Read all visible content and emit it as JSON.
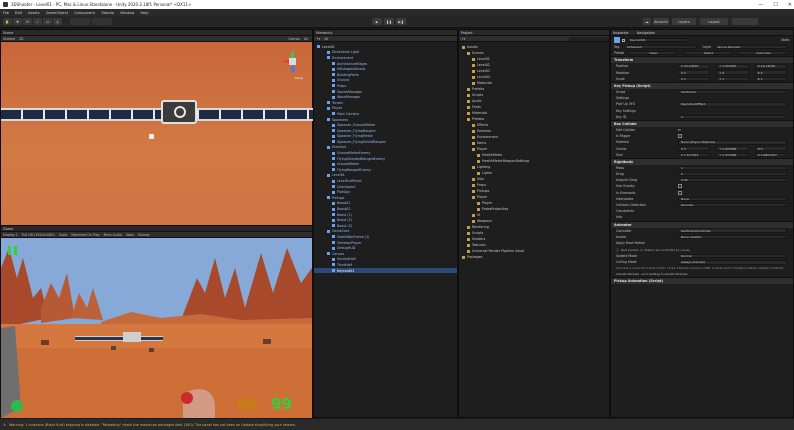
{
  "window": {
    "title": "3DShooter - Level01 - PC, Mac & Linux Standalone - Unity 2020.3.18f1 Personal* <DX11>",
    "min": "—",
    "max": "☐",
    "close": "✕"
  },
  "menu": [
    "File",
    "Edit",
    "Assets",
    "GameObject",
    "Component",
    "Tutorial",
    "Window",
    "Help"
  ],
  "toolbar": {
    "layers": "Layers",
    "layout": "Layout",
    "account": "Account"
  },
  "scene": {
    "tab": "Scene",
    "shading": "Shaded",
    "mode": "2D",
    "gizmos": "Gizmos",
    "search": "All",
    "persp": "Persp"
  },
  "game": {
    "tab": "Game",
    "display": "Display 1",
    "resolution": "Full HD (1920x1080)",
    "scale": "Scale",
    "maximize": "Maximize On Play",
    "mute": "Mute Audio",
    "stats": "Stats",
    "gizmos": "Gizmos",
    "ammo": "99",
    "pause_icon": "pause-icon"
  },
  "hierarchy": {
    "tab": "Hierarchy",
    "search": "All",
    "rows": [
      {
        "t": "Level01",
        "d": 0,
        "c": "dim"
      },
      {
        "t": "Directional Light",
        "d": 2
      },
      {
        "t": "Environment",
        "d": 2
      },
      {
        "t": "ArchitectureEdges",
        "d": 3
      },
      {
        "t": "HillshapesDetails",
        "d": 3
      },
      {
        "t": "BuildingParts",
        "d": 3
      },
      {
        "t": "Ground",
        "d": 3
      },
      {
        "t": "Props",
        "d": 3
      },
      {
        "t": "SpawnManager",
        "d": 3
      },
      {
        "t": "WaveManager",
        "d": 3
      },
      {
        "t": "Terrain",
        "d": 2
      },
      {
        "t": "Player",
        "d": 2
      },
      {
        "t": "Main Camera",
        "d": 3
      },
      {
        "t": "Spawners",
        "d": 2
      },
      {
        "t": "Spawner_GroundMelee",
        "d": 3
      },
      {
        "t": "Spawner_FlyingRanged",
        "d": 3
      },
      {
        "t": "Spawner_FlyingMelee",
        "d": 3
      },
      {
        "t": "Spawner_FlyingShieldRanged",
        "d": 3
      },
      {
        "t": "Enemies",
        "d": 2
      },
      {
        "t": "GroundMeleeEnemy",
        "d": 3
      },
      {
        "t": "FlyingShieldedRangedEnemy",
        "d": 3
      },
      {
        "t": "GroundMelee",
        "d": 3
      },
      {
        "t": "FlyingRangedEnemy",
        "d": 3
      },
      {
        "t": "Level01",
        "d": 2
      },
      {
        "t": "LevelEndPortal",
        "d": 3
      },
      {
        "t": "Checkpoint",
        "d": 3
      },
      {
        "t": "PlotSign",
        "d": 3
      },
      {
        "t": "Pickups",
        "d": 2
      },
      {
        "t": "Boost01",
        "d": 3
      },
      {
        "t": "Boost02",
        "d": 3
      },
      {
        "t": "Boost (1)",
        "d": 3
      },
      {
        "t": "Boost (2)",
        "d": 3
      },
      {
        "t": "Boost (3)",
        "d": 3
      },
      {
        "t": "GameCore",
        "d": 2
      },
      {
        "t": "HealthBarFrame (1)",
        "d": 3
      },
      {
        "t": "SkeletonPlayer",
        "d": 3
      },
      {
        "t": "DebugHUD",
        "d": 3
      },
      {
        "t": "Canvas",
        "d": 2
      },
      {
        "t": "SecondHalf",
        "d": 3
      },
      {
        "t": "ThirdHalf",
        "d": 3
      },
      {
        "t": "Keycard01",
        "d": 3,
        "c": "sel"
      }
    ]
  },
  "project": {
    "tab": "Project",
    "rows": [
      {
        "t": "Assets",
        "d": 0
      },
      {
        "t": "Scenes",
        "d": 1
      },
      {
        "t": "Level01",
        "d": 2
      },
      {
        "t": "Level02",
        "d": 2
      },
      {
        "t": "Level03",
        "d": 2
      },
      {
        "t": "Level04",
        "d": 2
      },
      {
        "t": "Materials",
        "d": 2
      },
      {
        "t": "Prefabs",
        "d": 1
      },
      {
        "t": "Scripts",
        "d": 1
      },
      {
        "t": "Audio",
        "d": 1
      },
      {
        "t": "Fonts",
        "d": 1
      },
      {
        "t": "Materials",
        "d": 1
      },
      {
        "t": "Prefabs",
        "d": 1
      },
      {
        "t": "Effects",
        "d": 2
      },
      {
        "t": "Enemies",
        "d": 2
      },
      {
        "t": "Environment",
        "d": 2
      },
      {
        "t": "Items",
        "d": 2
      },
      {
        "t": "Player",
        "d": 2
      },
      {
        "t": "HealthMeter",
        "d": 3
      },
      {
        "t": "HealthMeterWeaponSettings",
        "d": 3
      },
      {
        "t": "Lighting",
        "d": 2
      },
      {
        "t": "Lights",
        "d": 3
      },
      {
        "t": "Misc",
        "d": 2
      },
      {
        "t": "Props",
        "d": 2
      },
      {
        "t": "Pickups",
        "d": 2
      },
      {
        "t": "Player",
        "d": 2
      },
      {
        "t": "Player",
        "d": 3
      },
      {
        "t": "ProbeProjectiles",
        "d": 3
      },
      {
        "t": "UI",
        "d": 2
      },
      {
        "t": "Weapons",
        "d": 2
      },
      {
        "t": "Rendering",
        "d": 1
      },
      {
        "t": "Scripts",
        "d": 1
      },
      {
        "t": "Shaders",
        "d": 1
      },
      {
        "t": "Textures",
        "d": 1
      },
      {
        "t": "Universal Render Pipeline Asset",
        "d": 1
      },
      {
        "t": "Packages",
        "d": 0
      }
    ]
  },
  "inspector": {
    "tab": "Inspector",
    "tab2": "Navigation",
    "name": "Keycard01",
    "static": "Static",
    "tag_label": "Tag",
    "tag": "Untagged",
    "layer_label": "Layer",
    "layer": "Ignore Raycast",
    "prefab_label": "Prefab",
    "open": "Open",
    "select": "Select",
    "overrides": "Overrides",
    "transform": {
      "title": "Transform",
      "position": "Position",
      "rotation": "Rotation",
      "scale": "Scale",
      "pos": [
        "X 53.93679",
        "Y 1.553923",
        "Z 19.14536"
      ],
      "rot": [
        "X 0",
        "Y 0",
        "Z 0"
      ],
      "scl": [
        "X 1",
        "Y 1",
        "Z 1"
      ]
    },
    "pickup": {
      "title": "Key Pickup (Script)",
      "script": "Script",
      "script_val": "KeyPickup",
      "settings": "Settings",
      "vfx": "Pick Up VFX",
      "vfx_val": "KeyCollectEffect",
      "key_settings": "Key Settings",
      "key_id": "Key ID",
      "key_id_val": "1"
    },
    "collider": {
      "title": "Box Collider",
      "edit": "Edit Collider",
      "trigger": "Is Trigger",
      "material": "Material",
      "material_val": "None (Physic Material)",
      "center": "Center",
      "center_val": [
        "X 0",
        "Y 0.004898",
        "Z 0"
      ],
      "size": "Size",
      "size_val": [
        "X 1.677024",
        "Y 1.372089",
        "Z 0.4801567"
      ]
    },
    "rigidbody": {
      "title": "Rigidbody",
      "mass": "Mass",
      "mass_val": "1",
      "drag": "Drag",
      "drag_val": "0",
      "adrag": "Angular Drag",
      "adrag_val": "0.05",
      "gravity": "Use Gravity",
      "kinematic": "Is Kinematic",
      "interp": "Interpolate",
      "interp_val": "None",
      "coll": "Collision Detection",
      "coll_val": "Discrete",
      "constraints": "Constraints",
      "info": "Info"
    },
    "animator": {
      "title": "Animator",
      "controller": "Controller",
      "controller_val": "KeyPickupController",
      "avatar": "Avatar",
      "avatar_val": "None (Avatar)",
      "root": "Apply Root Motion",
      "note": "Root position or rotation are controlled by curves",
      "update": "Update Mode",
      "update_val": "Normal",
      "culling": "Culling Mode",
      "culling_val": "Always Animate",
      "clip_note": "Clip Count: 1 Curves Pos: 0 Quat: 0 Euler: 1 Scale: 0 Muscles: 0 Generic: 0 PPtr: 0 Curves Count: 3 Constant: 0 Dense: 0 Stream: 3 (100.0%)",
      "win_note": "Activate Windows - Go to Settings to activate Windows.",
      "pickup_anim": "Pickup Animation (Script)"
    }
  },
  "status": "Warning: 1 cutscene (Black Kurt) skipping is disabled. \"Reloading\" check the maximum packages limit (100). The panel has not been on Update simplifying your stream.",
  "colors": {
    "accent": "#2c4a78",
    "hier_text": "#9bb9f0",
    "sky": "#7fa5d5",
    "ground": "#d27a45",
    "ammo": "#2fd23a"
  }
}
